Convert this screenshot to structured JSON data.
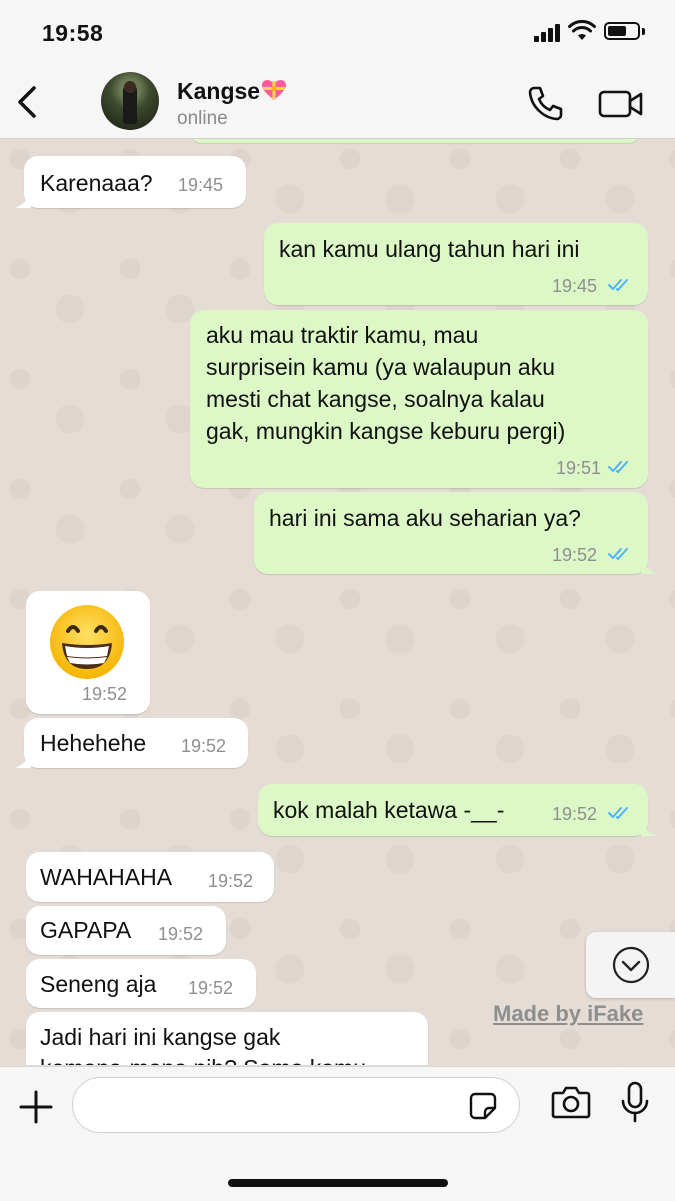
{
  "status_bar": {
    "time": "19:58"
  },
  "header": {
    "contact_name": "Kangse",
    "status": "online"
  },
  "messages": [
    {
      "dir": "in",
      "text": "Karenaaa?",
      "time": "19:45"
    },
    {
      "dir": "out",
      "text": "kan kamu ulang tahun hari ini",
      "time": "19:45",
      "read": true
    },
    {
      "dir": "out",
      "lines": [
        "aku mau traktir kamu, mau",
        "surprisein kamu (ya walaupun aku",
        "mesti chat kangse, soalnya kalau",
        "gak, mungkin kangse keburu pergi)"
      ],
      "time": "19:51",
      "read": true
    },
    {
      "dir": "out",
      "text": "hari ini sama aku seharian ya?",
      "time": "19:52",
      "read": true
    },
    {
      "dir": "in",
      "emoji": "grinning-face",
      "time": "19:52"
    },
    {
      "dir": "in",
      "text": "Hehehehe",
      "time": "19:52"
    },
    {
      "dir": "out",
      "text": "kok malah ketawa -__-",
      "time": "19:52",
      "read": true
    },
    {
      "dir": "in",
      "text": "WAHAHAHA",
      "time": "19:52"
    },
    {
      "dir": "in",
      "text": "GAPAPA",
      "time": "19:52"
    },
    {
      "dir": "in",
      "text": "Seneng aja",
      "time": "19:52"
    },
    {
      "dir": "in",
      "lines": [
        "Jadi hari ini kangse gak",
        "kemana-mana nih? Sama kamu"
      ]
    }
  ],
  "watermark": "Made by iFake",
  "colors": {
    "incoming_bubble": "#ffffff",
    "outgoing_bubble": "#dcf8c6",
    "read_ticks": "#4fb3f6",
    "chat_background": "#e5ddd5"
  }
}
